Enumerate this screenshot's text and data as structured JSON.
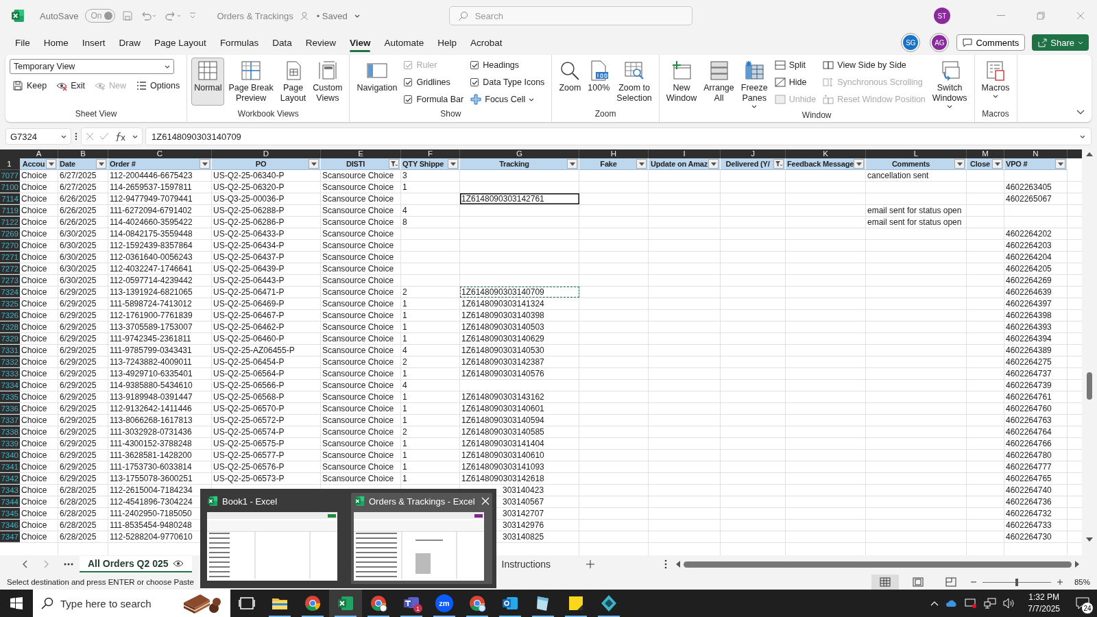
{
  "title_bar": {
    "autosave_label": "AutoSave",
    "autosave": {
      "text": "On",
      "on": true
    },
    "doc_title": "Orders & Trackings",
    "save_state": "• Saved",
    "search_placeholder": "Search",
    "user_initials": "ST"
  },
  "menu": {
    "tabs": [
      {
        "label": "File",
        "selected": false
      },
      {
        "label": "Home",
        "selected": false
      },
      {
        "label": "Insert",
        "selected": false
      },
      {
        "label": "Draw",
        "selected": false
      },
      {
        "label": "Page Layout",
        "selected": false
      },
      {
        "label": "Formulas",
        "selected": false
      },
      {
        "label": "Data",
        "selected": false
      },
      {
        "label": "Review",
        "selected": false
      },
      {
        "label": "View",
        "selected": true
      },
      {
        "label": "Automate",
        "selected": false
      },
      {
        "label": "Help",
        "selected": false
      },
      {
        "label": "Acrobat",
        "selected": false
      }
    ],
    "collaborators": [
      {
        "initials": "SG",
        "color": "#1a73c8"
      },
      {
        "initials": "AG",
        "color": "#8a2a9c"
      }
    ],
    "comments_button": "Comments",
    "share_button": "Share"
  },
  "ribbon": {
    "groups": [
      {
        "label": "Sheet View",
        "kind": "rows",
        "rows": [
          [
            {
              "kind": "dropdown",
              "value": "Temporary View"
            }
          ],
          [
            {
              "kind": "small",
              "label": "Keep",
              "disabled": false
            },
            {
              "kind": "small",
              "label": "Exit",
              "disabled": false
            },
            {
              "kind": "small",
              "label": "New",
              "disabled": true
            },
            {
              "kind": "small",
              "label": "Options",
              "disabled": false
            }
          ]
        ]
      },
      {
        "label": "Workbook Views",
        "kind": "columns",
        "columns": [
          [
            {
              "kind": "large",
              "label": "Normal",
              "selected": true
            }
          ],
          [
            {
              "kind": "large",
              "label": "Page Break\nPreview",
              "selected": false
            }
          ],
          [
            {
              "kind": "large",
              "label": "Page\nLayout",
              "selected": false
            }
          ],
          [
            {
              "kind": "large",
              "label": "Custom\nViews",
              "selected": false
            }
          ]
        ]
      },
      {
        "label": "Show",
        "kind": "columns",
        "columns": [
          [
            {
              "kind": "large",
              "label": "Navigation",
              "selected": false
            }
          ],
          [
            {
              "kind": "check",
              "label": "Ruler",
              "checked": true,
              "disabled": true
            },
            {
              "kind": "check",
              "label": "Gridlines",
              "checked": true,
              "disabled": false
            },
            {
              "kind": "check",
              "label": "Formula Bar",
              "checked": true,
              "disabled": false
            }
          ],
          [
            {
              "kind": "check",
              "label": "Headings",
              "checked": true,
              "disabled": false
            },
            {
              "kind": "check",
              "label": "Data Type Icons",
              "checked": true,
              "disabled": false
            },
            {
              "kind": "small",
              "label": "Focus Cell",
              "disabled": false,
              "has_menu": true
            }
          ]
        ]
      },
      {
        "label": "Zoom",
        "kind": "columns",
        "columns": [
          [
            {
              "kind": "large",
              "label": "Zoom",
              "selected": false
            }
          ],
          [
            {
              "kind": "large",
              "label": "100%",
              "selected": false
            }
          ],
          [
            {
              "kind": "large",
              "label": "Zoom to\nSelection",
              "selected": false
            }
          ]
        ]
      },
      {
        "label": "Window",
        "kind": "columns",
        "columns": [
          [
            {
              "kind": "large",
              "label": "New\nWindow",
              "selected": false
            }
          ],
          [
            {
              "kind": "large",
              "label": "Arrange\nAll",
              "selected": false
            }
          ],
          [
            {
              "kind": "large",
              "label": "Freeze\nPanes",
              "selected": false,
              "has_menu": true
            }
          ],
          [
            {
              "kind": "small",
              "label": "Split",
              "disabled": false
            },
            {
              "kind": "small",
              "label": "Hide",
              "disabled": false
            },
            {
              "kind": "small",
              "label": "Unhide",
              "disabled": true
            }
          ],
          [
            {
              "kind": "small",
              "label": "View Side by Side",
              "disabled": false
            },
            {
              "kind": "small",
              "label": "Synchronous Scrolling",
              "disabled": true
            },
            {
              "kind": "small",
              "label": "Reset Window Position",
              "disabled": true
            }
          ],
          [
            {
              "kind": "large",
              "label": "Switch\nWindows",
              "selected": false,
              "has_menu": true
            }
          ]
        ]
      },
      {
        "label": "Macros",
        "kind": "columns",
        "columns": [
          [
            {
              "kind": "large",
              "label": "Macros",
              "selected": false,
              "has_menu": true
            }
          ]
        ]
      }
    ]
  },
  "formula_bar": {
    "name_box": "G7324",
    "formula": "1Z6148090303140709"
  },
  "sheet": {
    "columns": [
      {
        "letter": "A",
        "header": "Accou",
        "filtered": false
      },
      {
        "letter": "B",
        "header": "Date",
        "filtered": false
      },
      {
        "letter": "C",
        "header": "Order #",
        "filtered": false
      },
      {
        "letter": "D",
        "header": "PO",
        "filtered": false
      },
      {
        "letter": "E",
        "header": "DISTI",
        "filtered": true
      },
      {
        "letter": "F",
        "header": "QTY Shippe",
        "filtered": false
      },
      {
        "letter": "G",
        "header": "Tracking",
        "filtered": false
      },
      {
        "letter": "H",
        "header": "Fake",
        "filtered": false
      },
      {
        "letter": "I",
        "header": "Update on Amaz",
        "filtered": false
      },
      {
        "letter": "J",
        "header": "Delivered (Y/",
        "filtered": true
      },
      {
        "letter": "K",
        "header": "Feedback Message",
        "filtered": false
      },
      {
        "letter": "L",
        "header": "Comments",
        "filtered": false
      },
      {
        "letter": "M",
        "header": "Close",
        "filtered": false
      },
      {
        "letter": "N",
        "header": "VPO #",
        "filtered": false
      }
    ],
    "header_row": "1",
    "rows": [
      {
        "num": "7077",
        "selected": false,
        "copied": false,
        "covered": false,
        "cells": {
          "A": "Choice",
          "B": "6/27/2025",
          "C": "112-2004446-6675423",
          "D": "US-Q2-25-06340-P",
          "E": "Scansource Choice",
          "F": "3",
          "L": "cancellation sent"
        }
      },
      {
        "num": "7100",
        "selected": false,
        "copied": false,
        "covered": false,
        "cells": {
          "A": "Choice",
          "B": "6/27/2025",
          "C": "114-2659537-1597811",
          "D": "US-Q2-25-06320-P",
          "E": "Scansource Choice",
          "F": "1",
          "N": "4602263405"
        }
      },
      {
        "num": "7114",
        "selected": true,
        "copied": false,
        "covered": false,
        "cells": {
          "A": "Choice",
          "B": "6/26/2025",
          "C": "112-9477949-7079441",
          "D": "US-Q3-25-00036-P",
          "E": "Scansource Choice",
          "G": "1Z6148090303142761",
          "N": "4602265067"
        }
      },
      {
        "num": "7119",
        "selected": false,
        "copied": false,
        "covered": false,
        "cells": {
          "A": "Choice",
          "B": "6/26/2025",
          "C": "111-6272094-6791402",
          "D": "US-Q2-25-06288-P",
          "E": "Scansource Choice",
          "F": "4",
          "L": "email sent for status open"
        }
      },
      {
        "num": "7122",
        "selected": false,
        "copied": false,
        "covered": false,
        "cells": {
          "A": "Choice",
          "B": "6/26/2025",
          "C": "114-4024660-3595422",
          "D": "US-Q2-25-06286-P",
          "E": "Scansource Choice",
          "F": "8",
          "L": "email sent for status open"
        }
      },
      {
        "num": "7269",
        "selected": false,
        "copied": false,
        "covered": false,
        "cells": {
          "A": "Choice",
          "B": "6/30/2025",
          "C": "114-0842175-3559448",
          "D": "US-Q2-25-06433-P",
          "E": "Scansource Choice",
          "N": "4602264202"
        }
      },
      {
        "num": "7270",
        "selected": false,
        "copied": false,
        "covered": false,
        "cells": {
          "A": "Choice",
          "B": "6/30/2025",
          "C": "112-1592439-8357864",
          "D": "US-Q2-25-06434-P",
          "E": "Scansource Choice",
          "N": "4602264203"
        }
      },
      {
        "num": "7271",
        "selected": false,
        "copied": false,
        "covered": false,
        "cells": {
          "A": "Choice",
          "B": "6/30/2025",
          "C": "112-0361640-0056243",
          "D": "US-Q2-25-06437-P",
          "E": "Scansource Choice",
          "N": "4602264204"
        }
      },
      {
        "num": "7272",
        "selected": false,
        "copied": false,
        "covered": false,
        "cells": {
          "A": "Choice",
          "B": "6/30/2025",
          "C": "112-4032247-1746641",
          "D": "US-Q2-25-06439-P",
          "E": "Scansource Choice",
          "N": "4602264205"
        }
      },
      {
        "num": "7273",
        "selected": false,
        "copied": false,
        "covered": false,
        "cells": {
          "A": "Choice",
          "B": "6/30/2025",
          "C": "112-0597714-4239442",
          "D": "US-Q2-25-06443-P",
          "E": "Scansource Choice",
          "N": "4602264269"
        }
      },
      {
        "num": "7324",
        "selected": false,
        "copied": true,
        "covered": false,
        "cells": {
          "A": "Choice",
          "B": "6/29/2025",
          "C": "113-1391924-6821065",
          "D": "US-Q2-25-06471-P",
          "E": "Scansource Choice",
          "F": "2",
          "G": "1Z6148090303140709",
          "N": "4602264639"
        }
      },
      {
        "num": "7325",
        "selected": false,
        "copied": false,
        "covered": false,
        "cells": {
          "A": "Choice",
          "B": "6/29/2025",
          "C": "111-5898724-7413012",
          "D": "US-Q2-25-06469-P",
          "E": "Scansource Choice",
          "F": "1",
          "G": "1Z6148090303141324",
          "N": "4602264397"
        }
      },
      {
        "num": "7326",
        "selected": false,
        "copied": false,
        "covered": false,
        "cells": {
          "A": "Choice",
          "B": "6/29/2025",
          "C": "112-1761900-7761839",
          "D": "US-Q2-25-06467-P",
          "E": "Scansource Choice",
          "F": "1",
          "G": "1Z6148090303140398",
          "N": "4602264398"
        }
      },
      {
        "num": "7328",
        "selected": false,
        "copied": false,
        "covered": false,
        "cells": {
          "A": "Choice",
          "B": "6/29/2025",
          "C": "113-3705589-1753007",
          "D": "US-Q2-25-06462-P",
          "E": "Scansource Choice",
          "F": "1",
          "G": "1Z6148090303140503",
          "N": "4602264393"
        }
      },
      {
        "num": "7329",
        "selected": false,
        "copied": false,
        "covered": false,
        "cells": {
          "A": "Choice",
          "B": "6/29/2025",
          "C": "111-9742345-2361811",
          "D": "US-Q2-25-06460-P",
          "E": "Scansource Choice",
          "F": "1",
          "G": "1Z6148090303140629",
          "N": "4602264394"
        }
      },
      {
        "num": "7331",
        "selected": false,
        "copied": false,
        "covered": false,
        "cells": {
          "A": "Choice",
          "B": "6/29/2025",
          "C": "111-9785799-0343431",
          "D": "US-Q2-25-AZ06455-P",
          "E": "Scansource Choice",
          "F": "4",
          "G": "1Z6148090303140530",
          "N": "4602264389"
        }
      },
      {
        "num": "7332",
        "selected": false,
        "copied": false,
        "covered": false,
        "cells": {
          "A": "Choice",
          "B": "6/29/2025",
          "C": "113-7243882-4009011",
          "D": "US-Q2-25-06454-P",
          "E": "Scansource Choice",
          "F": "2",
          "G": "1Z6148090303142387",
          "N": "4602264275"
        }
      },
      {
        "num": "7333",
        "selected": false,
        "copied": false,
        "covered": false,
        "cells": {
          "A": "Choice",
          "B": "6/29/2025",
          "C": "113-4929710-6335401",
          "D": "US-Q2-25-06564-P",
          "E": "Scansource Choice",
          "F": "1",
          "G": "1Z6148090303140576",
          "N": "4602264737"
        }
      },
      {
        "num": "7334",
        "selected": false,
        "copied": false,
        "covered": false,
        "cells": {
          "A": "Choice",
          "B": "6/29/2025",
          "C": "114-9385880-5434610",
          "D": "US-Q2-25-06566-P",
          "E": "Scansource Choice",
          "F": "4",
          "N": "4602264739"
        }
      },
      {
        "num": "7335",
        "selected": false,
        "copied": false,
        "covered": false,
        "cells": {
          "A": "Choice",
          "B": "6/29/2025",
          "C": "113-9189948-0391447",
          "D": "US-Q2-25-06568-P",
          "E": "Scansource Choice",
          "F": "1",
          "G": "1Z6148090303143162",
          "N": "4602264761"
        }
      },
      {
        "num": "7336",
        "selected": false,
        "copied": false,
        "covered": false,
        "cells": {
          "A": "Choice",
          "B": "6/29/2025",
          "C": "112-9132642-1411446",
          "D": "US-Q2-25-06570-P",
          "E": "Scansource Choice",
          "F": "1",
          "G": "1Z6148090303140601",
          "N": "4602264760"
        }
      },
      {
        "num": "7337",
        "selected": false,
        "copied": false,
        "covered": false,
        "cells": {
          "A": "Choice",
          "B": "6/29/2025",
          "C": "113-8066268-1617813",
          "D": "US-Q2-25-06572-P",
          "E": "Scansource Choice",
          "F": "1",
          "G": "1Z6148090303140594",
          "N": "4602264763"
        }
      },
      {
        "num": "7338",
        "selected": false,
        "copied": false,
        "covered": false,
        "cells": {
          "A": "Choice",
          "B": "6/29/2025",
          "C": "111-3032928-0731436",
          "D": "US-Q2-25-06574-P",
          "E": "Scansource Choice",
          "F": "2",
          "G": "1Z6148090303140585",
          "N": "4602264764"
        }
      },
      {
        "num": "7339",
        "selected": false,
        "copied": false,
        "covered": false,
        "cells": {
          "A": "Choice",
          "B": "6/29/2025",
          "C": "111-4300152-3788248",
          "D": "US-Q2-25-06575-P",
          "E": "Scansource Choice",
          "F": "1",
          "G": "1Z6148090303141404",
          "N": "4602264766"
        }
      },
      {
        "num": "7340",
        "selected": false,
        "copied": false,
        "covered": false,
        "cells": {
          "A": "Choice",
          "B": "6/29/2025",
          "C": "111-3628581-1428200",
          "D": "US-Q2-25-06577-P",
          "E": "Scansource Choice",
          "F": "1",
          "G": "1Z6148090303140610",
          "N": "4602264780"
        }
      },
      {
        "num": "7341",
        "selected": false,
        "copied": false,
        "covered": false,
        "cells": {
          "A": "Choice",
          "B": "6/29/2025",
          "C": "111-1753730-6033814",
          "D": "US-Q2-25-06576-P",
          "E": "Scansource Choice",
          "F": "1",
          "G": "1Z6148090303141093",
          "N": "4602264777"
        }
      },
      {
        "num": "7342",
        "selected": false,
        "copied": false,
        "covered": false,
        "cells": {
          "A": "Choice",
          "B": "6/29/2025",
          "C": "113-1755078-3600251",
          "D": "US-Q2-25-06573-P",
          "E": "Scansource Choice",
          "F": "1",
          "G": "1Z6148090303142618",
          "N": "4602264765"
        }
      },
      {
        "num": "7343",
        "selected": false,
        "copied": false,
        "covered": true,
        "cells": {
          "A": "Choice",
          "B": "6/28/2025",
          "C": "112-2615004-7184234",
          "G": "303140423",
          "N": "4602264740"
        }
      },
      {
        "num": "7344",
        "selected": false,
        "copied": false,
        "covered": true,
        "cells": {
          "A": "Choice",
          "B": "6/28/2025",
          "C": "112-4541896-7304224",
          "G": "303140567",
          "N": "4602264736"
        }
      },
      {
        "num": "7345",
        "selected": false,
        "copied": false,
        "covered": true,
        "cells": {
          "A": "Choice",
          "B": "6/28/2025",
          "C": "111-2402950-7185050",
          "G": "303142707",
          "N": "4602264732"
        }
      },
      {
        "num": "7346",
        "selected": false,
        "copied": false,
        "covered": true,
        "cells": {
          "A": "Choice",
          "B": "6/28/2025",
          "C": "111-8535454-9480248",
          "G": "303142976",
          "N": "4602264733"
        }
      },
      {
        "num": "7347",
        "selected": false,
        "copied": false,
        "covered": true,
        "cells": {
          "A": "Choice",
          "B": "6/28/2025",
          "C": "112-5288204-9770610",
          "G": "303140825",
          "N": "4602264730"
        }
      }
    ]
  },
  "sheet_tabs": [
    {
      "label": "All Orders Q2 025",
      "selected": true,
      "sheet_view": true
    },
    {
      "label": "Instructions",
      "selected": false,
      "sheet_view": false
    }
  ],
  "status_bar": {
    "message": "Select destination and press ENTER or choose Paste",
    "views": [
      {
        "selected": true
      },
      {
        "selected": false
      },
      {
        "selected": false
      }
    ],
    "zoom": {
      "level": 0.5,
      "text": "85%"
    }
  },
  "window_previews": [
    {
      "title": "Book1 - Excel",
      "hovered": false
    },
    {
      "title": "Orders & Trackings - Excel",
      "hovered": true
    }
  ],
  "taskbar": {
    "search_placeholder": "Type here to search",
    "apps": [
      {
        "running": false,
        "active": false
      },
      {
        "running": true,
        "active": false
      },
      {
        "running": true,
        "active": false
      },
      {
        "running": true,
        "active": true
      },
      {
        "running": true,
        "active": false
      },
      {
        "running": true,
        "active": false,
        "badge": "1"
      },
      {
        "running": true,
        "active": false,
        "label": "zm"
      },
      {
        "running": true,
        "active": false
      },
      {
        "running": true,
        "active": false
      },
      {
        "running": true,
        "active": false
      },
      {
        "running": true,
        "active": false
      },
      {
        "running": true,
        "active": false
      }
    ],
    "time": "1:32 PM",
    "date": "7/7/2025",
    "notifications": "24"
  }
}
